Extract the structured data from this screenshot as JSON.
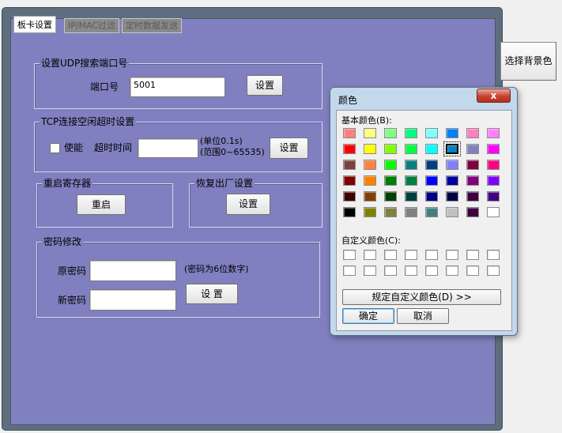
{
  "tabs": [
    {
      "label": "板卡设置",
      "active": true
    },
    {
      "label": "IP/MAC过滤",
      "active": false
    },
    {
      "label": "定时数据发送",
      "active": false
    }
  ],
  "udp_group": {
    "title": "设置UDP搜索端口号",
    "port_label": "端口号",
    "port_value": "5001",
    "set_button": "设置"
  },
  "tcp_group": {
    "title": "TCP连接空闲超时设置",
    "enable_label": "使能",
    "enabled": false,
    "timeout_label": "超时时间",
    "timeout_value": "",
    "unit_text": "(单位0.1s)",
    "range_text": "(范围0~65535)",
    "set_button": "设置"
  },
  "restart_group": {
    "title": "重启寄存器",
    "button": "重启"
  },
  "factory_group": {
    "title": "恢复出厂设置",
    "button": "设置"
  },
  "password_group": {
    "title": "密码修改",
    "old_label": "原密码",
    "old_value": "",
    "hint": "(密码为6位数字)",
    "new_label": "新密码",
    "new_value": "",
    "set_button": "设 置"
  },
  "side_button": "选择背景色",
  "color_dialog": {
    "title": "颜色",
    "close_label": "x",
    "basic_label": "基本颜色(B):",
    "custom_label": "自定义颜色(C):",
    "define_button": "规定自定义颜色(D) >>",
    "ok_button": "确定",
    "cancel_button": "取消",
    "selected_index": 13,
    "basic_colors": [
      "#ff8080",
      "#ffff80",
      "#80ff80",
      "#00ff80",
      "#80ffff",
      "#0080ff",
      "#ff80c0",
      "#ff80ff",
      "#ff0000",
      "#ffff00",
      "#80ff00",
      "#00ff40",
      "#00ffff",
      "#0080c0",
      "#8080c0",
      "#ff00ff",
      "#804040",
      "#ff8040",
      "#00ff00",
      "#008080",
      "#004080",
      "#8080ff",
      "#800040",
      "#ff0080",
      "#800000",
      "#ff8000",
      "#008000",
      "#008040",
      "#0000ff",
      "#0000a0",
      "#800080",
      "#8000ff",
      "#400000",
      "#804000",
      "#004000",
      "#004040",
      "#000080",
      "#000040",
      "#400040",
      "#400080",
      "#000000",
      "#808000",
      "#808040",
      "#808080",
      "#408080",
      "#c0c0c0",
      "#400040",
      "#ffffff"
    ],
    "custom_colors": [
      "#ffffff",
      "#ffffff",
      "#ffffff",
      "#ffffff",
      "#ffffff",
      "#ffffff",
      "#ffffff",
      "#ffffff",
      "#ffffff",
      "#ffffff",
      "#ffffff",
      "#ffffff",
      "#ffffff",
      "#ffffff",
      "#ffffff",
      "#ffffff"
    ]
  }
}
